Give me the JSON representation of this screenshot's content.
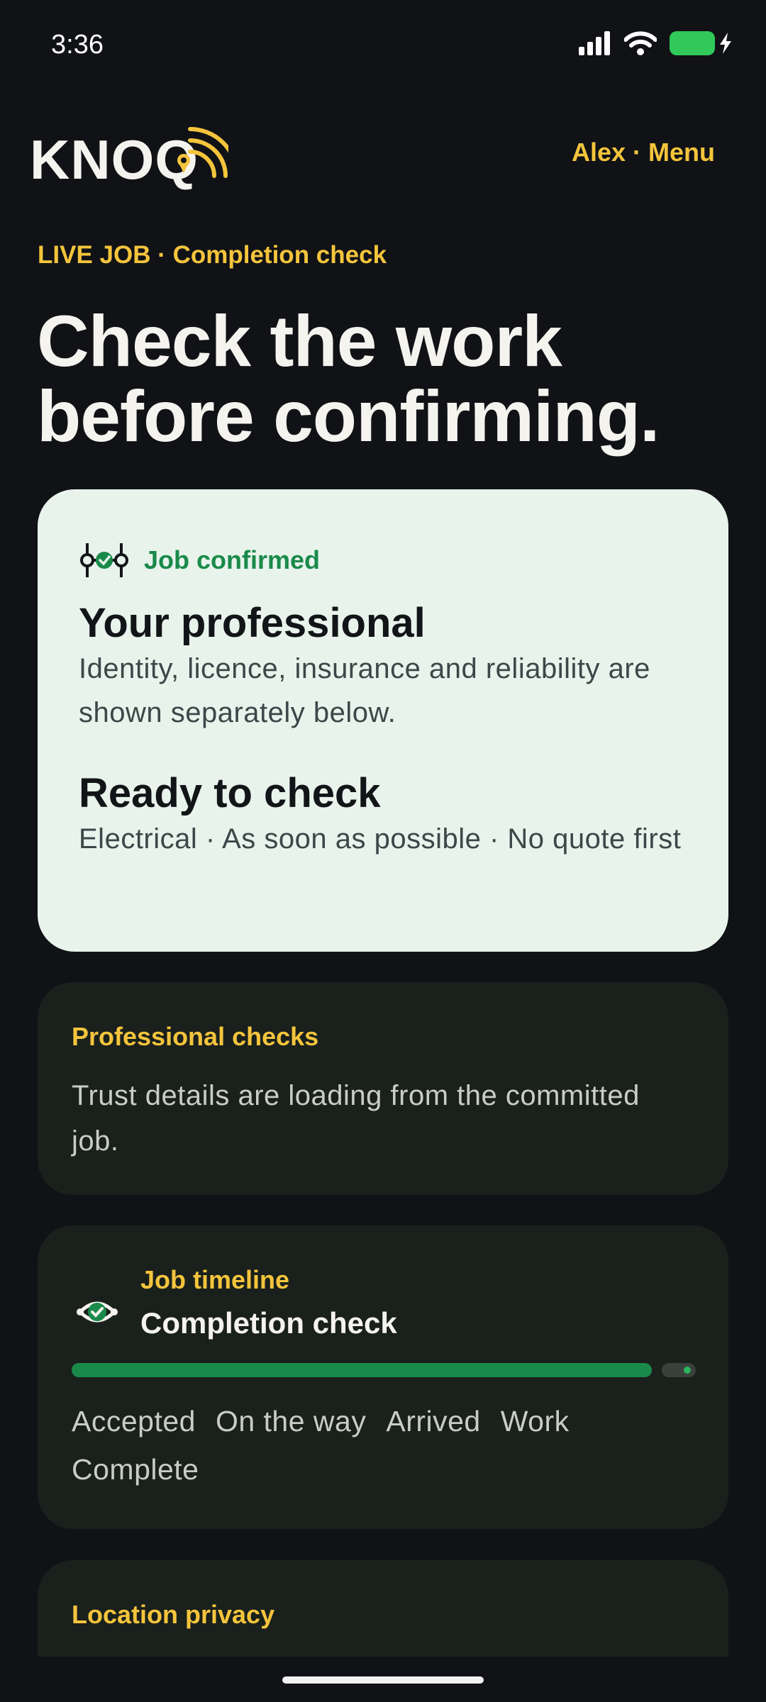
{
  "status": {
    "time": "3:36"
  },
  "header": {
    "logo_text": "KNOQ",
    "menu": "Alex · Menu"
  },
  "eyebrow": "LIVE JOB · Completion check",
  "hero": {
    "line1": "Check the work",
    "line2": "before confirming."
  },
  "job_card": {
    "status": "Job confirmed",
    "pro_heading": "Your professional",
    "pro_text": "Identity, licence, insurance and reliability are shown separately below.",
    "ready_heading": "Ready to check",
    "ready_text": "Electrical · As soon as possible · No quote first"
  },
  "checks_card": {
    "label": "Professional checks",
    "text": "Trust details are loading from the committed job."
  },
  "timeline": {
    "label": "Job timeline",
    "title": "Completion check",
    "progress_fraction": 0.93,
    "steps": [
      "Accepted",
      "On the way",
      "Arrived",
      "Work",
      "Complete"
    ]
  },
  "privacy_card": {
    "label": "Location privacy"
  },
  "colors": {
    "accent": "#f4c43c",
    "success": "#1a8a4a",
    "background": "#101216",
    "card_light": "#e8f3ec",
    "card_dark": "#1a201c"
  },
  "icons": {
    "signal": "signal-icon",
    "wifi": "wifi-icon",
    "battery": "battery-charging-icon",
    "confirmed": "job-confirmed-icon",
    "timeline": "timeline-check-icon"
  }
}
